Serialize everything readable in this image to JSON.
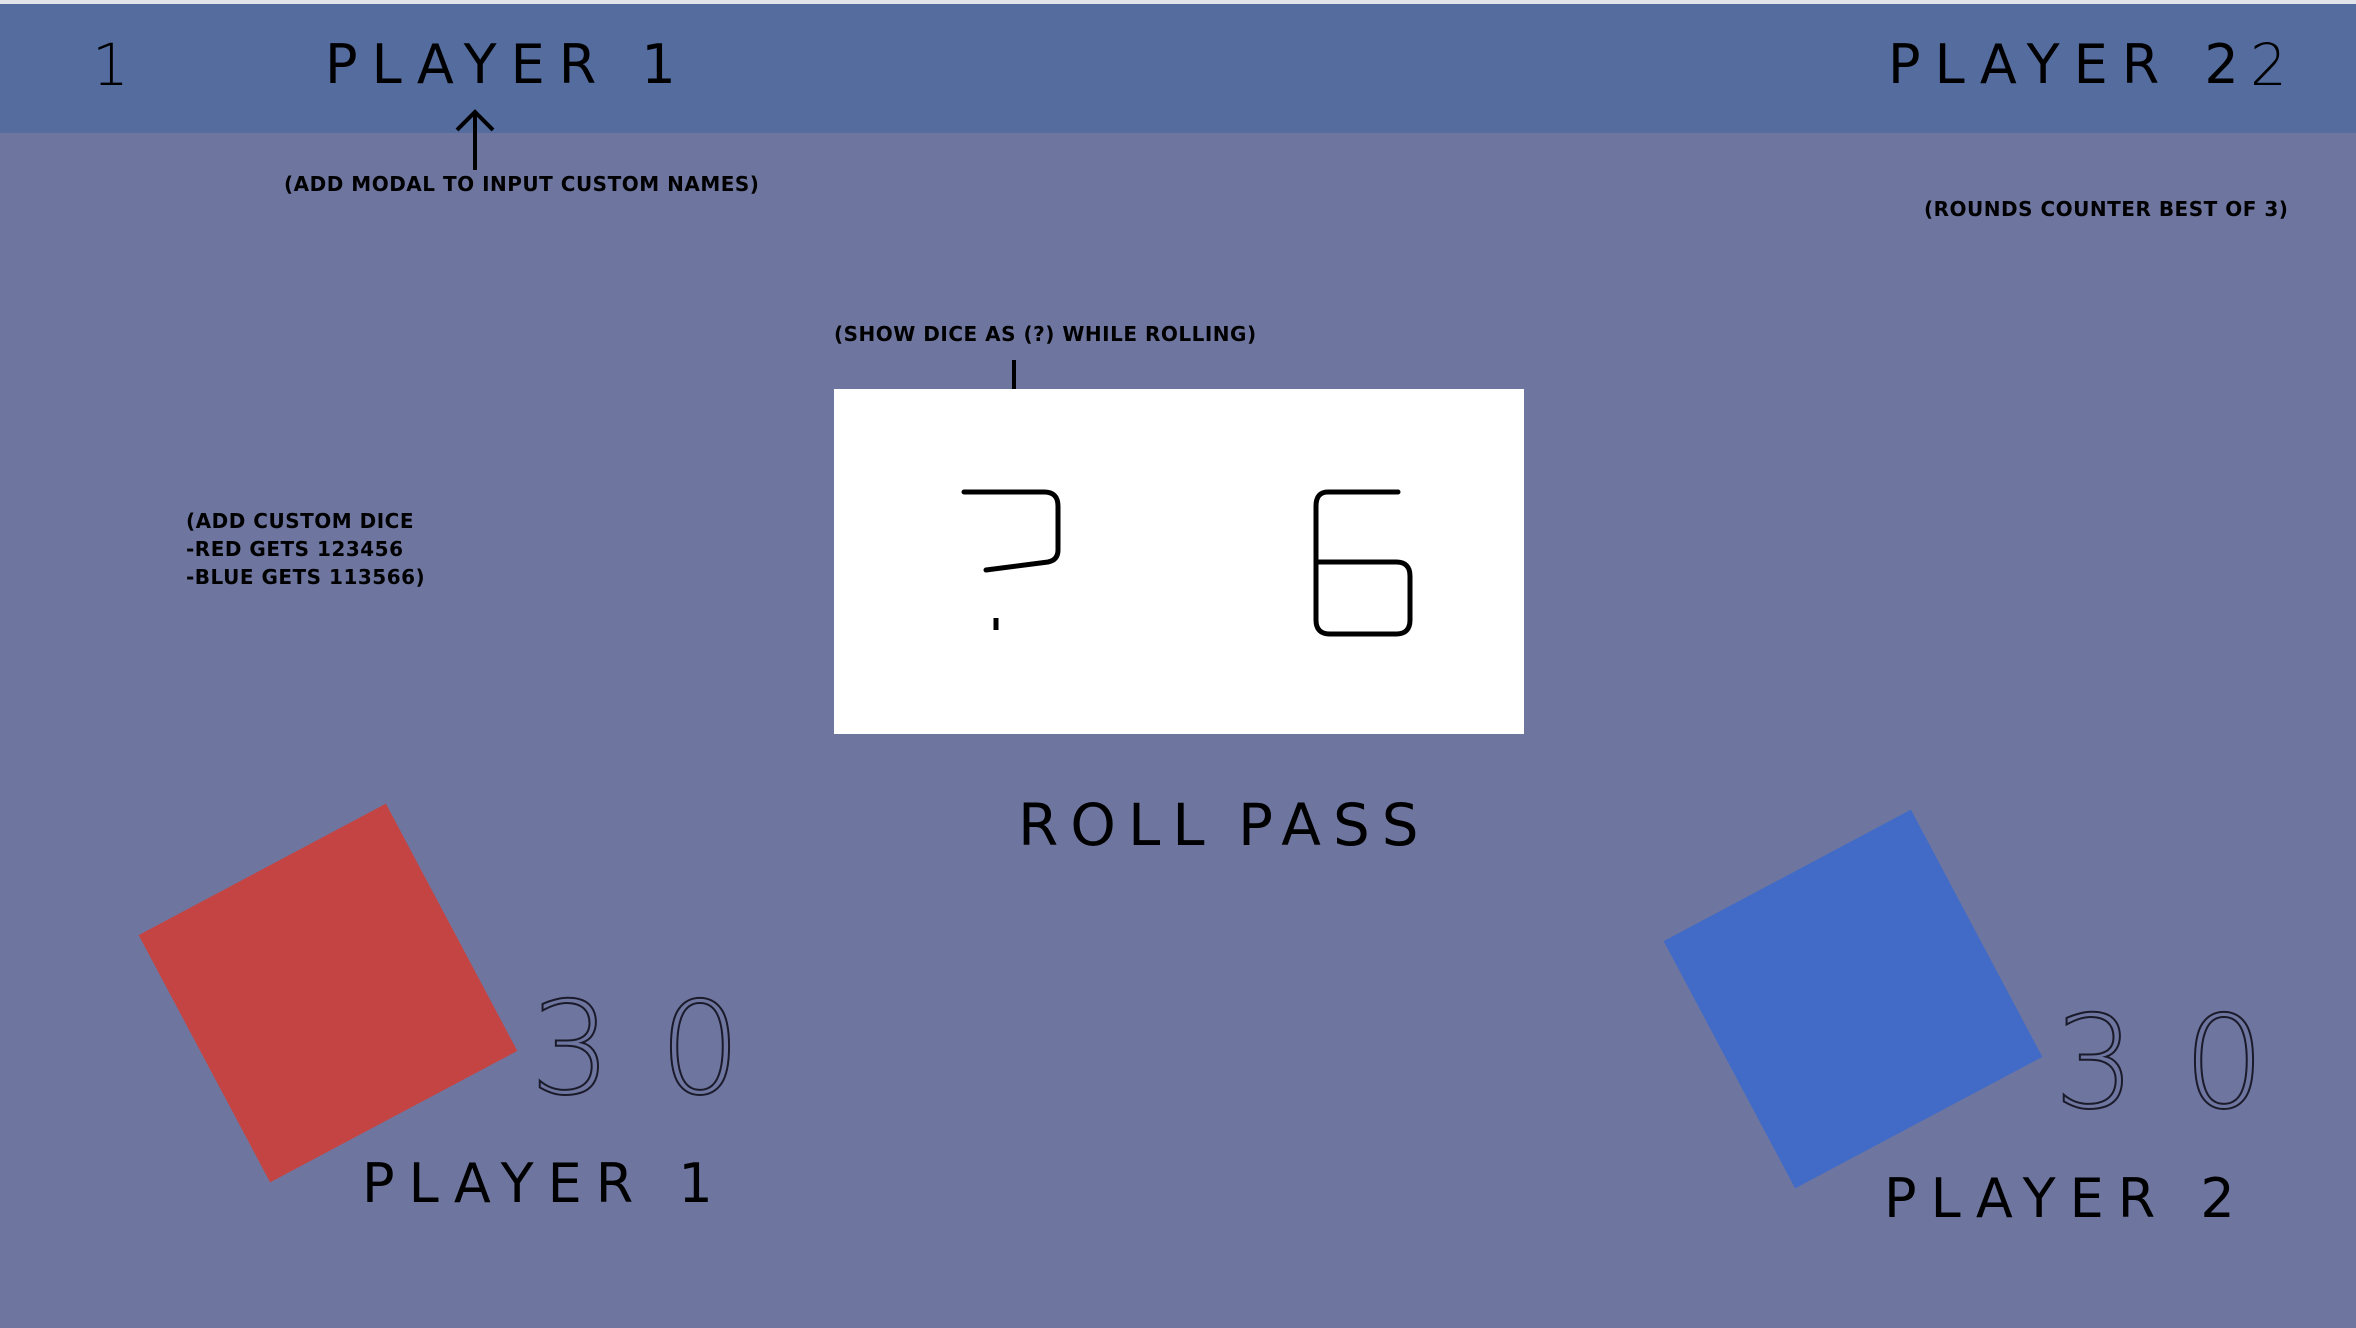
{
  "colors": {
    "background": "#6e76a0",
    "topbar": "#546c9e",
    "dice_panel": "#ffffff",
    "player1": "#c44443",
    "player2": "#416bc6"
  },
  "header": {
    "player1_rounds": "1",
    "player1_name": "PLAYER 1",
    "player2_name": "PLAYER 2",
    "player2_rounds": "2"
  },
  "notes": {
    "custom_names": "(ADD MODAL TO INPUT CUSTOM NAMES)",
    "rounds_counter": "(ROUNDS COUNTER BEST OF 3)",
    "show_dice": "(SHOW DICE AS (?) WHILE ROLLING)",
    "custom_dice": "(ADD CUSTOM DICE\n-RED GETS 123456\n-BLUE GETS 113566)"
  },
  "dice": {
    "left": "?",
    "right": "6"
  },
  "actions": {
    "roll": "ROLL",
    "pass": "PASS"
  },
  "player1": {
    "score": "30",
    "label": "PLAYER 1",
    "icon": "red-square"
  },
  "player2": {
    "score": "30",
    "label": "PLAYER 2",
    "icon": "blue-square"
  }
}
